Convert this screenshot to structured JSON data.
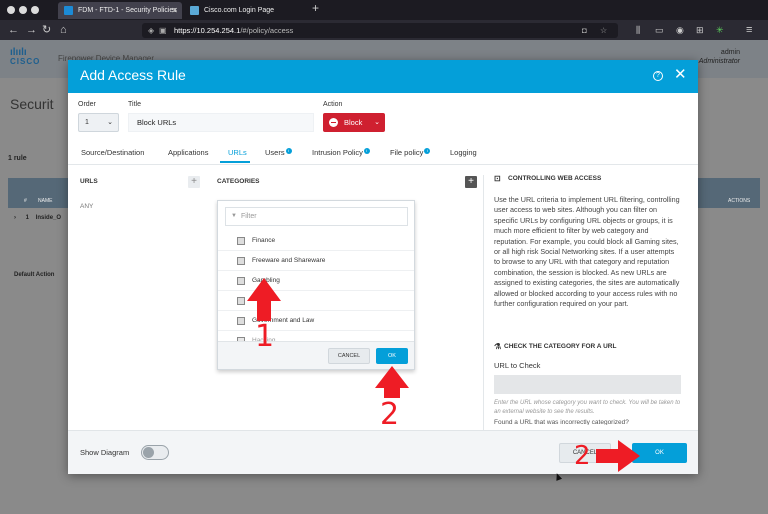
{
  "browser": {
    "tabs": [
      {
        "label": "FDM - FTD-1 - Security Policies"
      },
      {
        "label": "Cisco.com Login Page"
      }
    ],
    "url_host": "https://10.254.254.1",
    "url_path": "/#/policy/access"
  },
  "app": {
    "brand": "CISCO",
    "product": "Firepower Device Manager",
    "user_name": "admin",
    "user_role": "Administrator",
    "page_title": "Securit",
    "rule_count": "1 rule",
    "table_headers": {
      "num": "#",
      "name": "NAME",
      "actions": "ACTIONS"
    },
    "row": {
      "num": "1",
      "name": "Inside_O"
    },
    "default_action": "Default Action"
  },
  "modal": {
    "title": "Add Access Rule",
    "order_label": "Order",
    "order_value": "1",
    "title_label": "Title",
    "title_value": "Block URLs",
    "action_label": "Action",
    "action_value": "Block",
    "tabs": [
      {
        "label": "Source/Destination"
      },
      {
        "label": "Applications"
      },
      {
        "label": "URLs"
      },
      {
        "label": "Users"
      },
      {
        "label": "Intrusion Policy"
      },
      {
        "label": "File policy"
      },
      {
        "label": "Logging"
      }
    ],
    "urls_header": "URLS",
    "urls_any": "ANY",
    "categories_header": "CATEGORIES",
    "dropdown": {
      "filter_placeholder": "Filter",
      "items": [
        {
          "label": "Finance"
        },
        {
          "label": "Freeware and Shareware"
        },
        {
          "label": "Gambling"
        },
        {
          "label": ""
        },
        {
          "label": "Government and Law"
        },
        {
          "label": "Hacking"
        }
      ],
      "cancel": "CANCEL",
      "ok": "OK"
    },
    "info": {
      "heading": "CONTROLLING WEB ACCESS",
      "body": "Use the URL criteria to implement URL filtering, controlling user access to web sites. Although you can filter on specific URLs by configuring URL objects or groups, it is much more efficient to filter by web category and reputation. For example, you could block all Gaming sites, or all high risk Social Networking sites. If a user attempts to browse to any URL with that category and reputation combination, the session is blocked. As new URLs are assigned to existing categories, the sites are automatically allowed or blocked according to your access rules with no further configuration required on your part.",
      "check_heading": "CHECK THE CATEGORY FOR A URL",
      "url_label": "URL to Check",
      "hint": "Enter the URL whose category you want to check. You will be taken to an external website to see the results.",
      "found": "Found a URL that was incorrectly categorized?"
    },
    "footer": {
      "show_diagram": "Show Diagram",
      "cancel": "CANCEL",
      "ok": "OK"
    }
  },
  "annotations": {
    "n1": "1",
    "n2a": "2",
    "n2b": "2",
    "arrow_color": "#ee1c25"
  }
}
